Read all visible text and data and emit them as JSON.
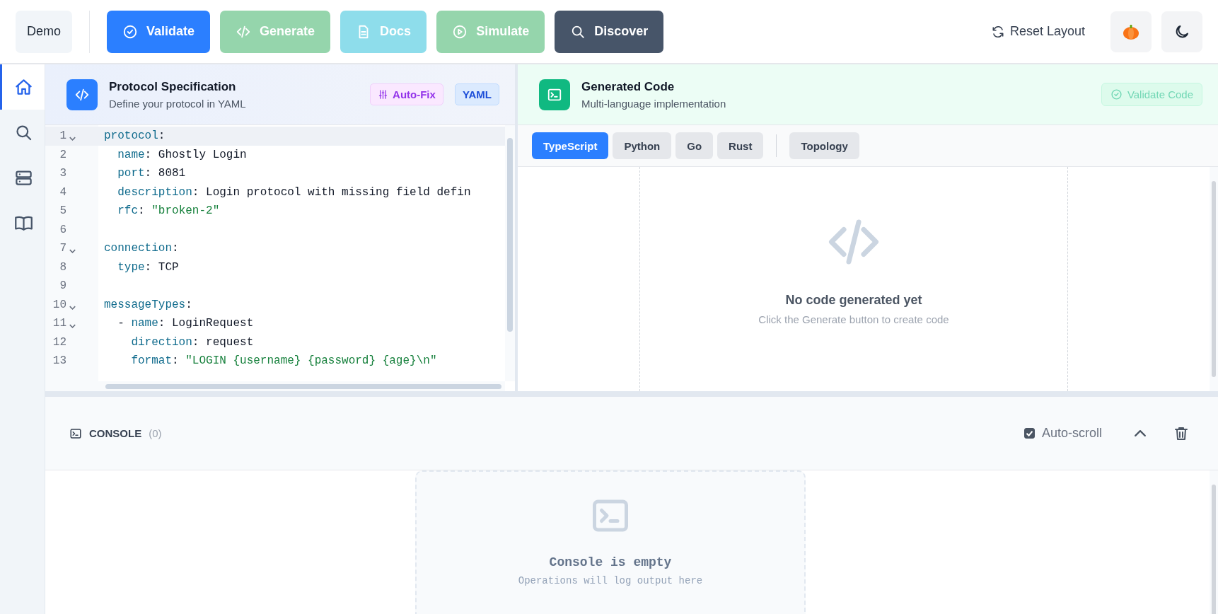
{
  "toolbar": {
    "buttons": [
      {
        "label": "Demo",
        "kind": "plain",
        "disabled": false
      },
      {
        "label": "Validate",
        "kind": "primary",
        "disabled": false
      },
      {
        "label": "Generate",
        "kind": "success",
        "disabled": true
      },
      {
        "label": "Docs",
        "kind": "info",
        "disabled": true
      },
      {
        "label": "Simulate",
        "kind": "success",
        "disabled": true
      },
      {
        "label": "Discover",
        "kind": "dark",
        "disabled": false
      }
    ],
    "reset_label": "Reset Layout"
  },
  "sidebar": {
    "items": [
      {
        "selected": true
      },
      {
        "selected": false
      },
      {
        "selected": false
      },
      {
        "selected": false
      }
    ]
  },
  "spec_panel": {
    "title": "Protocol Specification",
    "subtitle": "Define your protocol in YAML",
    "badges": [
      {
        "label": "Auto-Fix",
        "kind": "action"
      },
      {
        "label": "YAML",
        "kind": "format"
      }
    ],
    "lines": [
      {
        "number": "1",
        "foldable": true,
        "active": true,
        "tokens": [
          {
            "kind": "key",
            "text": "protocol"
          },
          {
            "kind": "punct",
            "text": ":"
          }
        ]
      },
      {
        "number": "2",
        "foldable": false,
        "active": false,
        "tokens": [
          {
            "kind": "key",
            "text": "  name"
          },
          {
            "kind": "punct",
            "text": ": "
          },
          {
            "kind": "plain",
            "text": "Ghostly Login"
          }
        ]
      },
      {
        "number": "3",
        "foldable": false,
        "active": false,
        "tokens": [
          {
            "kind": "key",
            "text": "  port"
          },
          {
            "kind": "punct",
            "text": ": "
          },
          {
            "kind": "plain",
            "text": "8081"
          }
        ]
      },
      {
        "number": "4",
        "foldable": false,
        "active": false,
        "tokens": [
          {
            "kind": "key",
            "text": "  description"
          },
          {
            "kind": "punct",
            "text": ": "
          },
          {
            "kind": "plain",
            "text": "Login protocol with missing field defin"
          }
        ]
      },
      {
        "number": "5",
        "foldable": false,
        "active": false,
        "tokens": [
          {
            "kind": "key",
            "text": "  rfc"
          },
          {
            "kind": "punct",
            "text": ": "
          },
          {
            "kind": "string",
            "text": "\"broken-2\""
          }
        ]
      },
      {
        "number": "6",
        "foldable": false,
        "active": false
      },
      {
        "number": "7",
        "foldable": true,
        "active": false,
        "tokens": [
          {
            "kind": "key",
            "text": "connection"
          },
          {
            "kind": "punct",
            "text": ":"
          }
        ]
      },
      {
        "number": "8",
        "foldable": false,
        "active": false,
        "tokens": [
          {
            "kind": "key",
            "text": "  type"
          },
          {
            "kind": "punct",
            "text": ": "
          },
          {
            "kind": "plain",
            "text": "TCP"
          }
        ]
      },
      {
        "number": "9",
        "foldable": false,
        "active": false
      },
      {
        "number": "10",
        "foldable": true,
        "active": false,
        "tokens": [
          {
            "kind": "key",
            "text": "messageTypes"
          },
          {
            "kind": "punct",
            "text": ":"
          }
        ]
      },
      {
        "number": "11",
        "foldable": true,
        "active": false,
        "tokens": [
          {
            "kind": "punct",
            "text": "  - "
          },
          {
            "kind": "key",
            "text": "name"
          },
          {
            "kind": "punct",
            "text": ": "
          },
          {
            "kind": "plain",
            "text": "LoginRequest"
          }
        ]
      },
      {
        "number": "12",
        "foldable": false,
        "active": false,
        "tokens": [
          {
            "kind": "key",
            "text": "    direction"
          },
          {
            "kind": "punct",
            "text": ": "
          },
          {
            "kind": "plain",
            "text": "request"
          }
        ]
      },
      {
        "number": "13",
        "foldable": false,
        "active": false,
        "tokens": [
          {
            "kind": "key",
            "text": "    format"
          },
          {
            "kind": "punct",
            "text": ": "
          },
          {
            "kind": "string",
            "text": "\"LOGIN {username} {password} {age}\\n\""
          }
        ]
      }
    ]
  },
  "code_panel": {
    "title": "Generated Code",
    "subtitle": "Multi-language implementation",
    "validate_button": {
      "label": "Validate Code",
      "disabled": true
    },
    "language_tabs": [
      {
        "label": "TypeScript",
        "selected": true
      },
      {
        "label": "Python",
        "selected": false
      },
      {
        "label": "Go",
        "selected": false
      },
      {
        "label": "Rust",
        "selected": false
      }
    ],
    "view_tabs": [
      {
        "label": "Topology",
        "selected": false
      }
    ],
    "empty_title": "No code generated yet",
    "empty_text": "Click the Generate button to create code"
  },
  "console": {
    "title": "CONSOLE",
    "count": "(0)",
    "auto_scroll": {
      "label": "Auto-scroll",
      "checked": true
    },
    "empty_title": "Console is empty",
    "empty_text": "Operations will log output here"
  }
}
